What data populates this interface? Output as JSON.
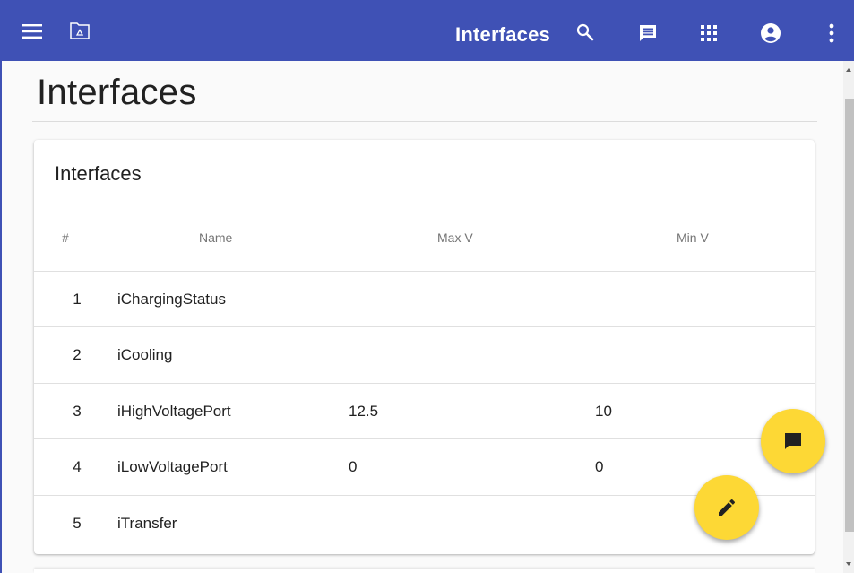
{
  "app_bar": {
    "title": "Interfaces",
    "background_color": "#3f51b5",
    "icons": [
      "menu-icon",
      "folder-icon",
      "search-icon",
      "chat-icon",
      "apps-icon",
      "account-icon",
      "more-vert-icon"
    ]
  },
  "page": {
    "title": "Interfaces"
  },
  "card": {
    "title": "Interfaces",
    "columns": [
      "#",
      "Name",
      "Max V",
      "Min V"
    ],
    "rows": [
      {
        "num": "1",
        "name": "iChargingStatus",
        "max_v": "",
        "min_v": ""
      },
      {
        "num": "2",
        "name": "iCooling",
        "max_v": "",
        "min_v": ""
      },
      {
        "num": "3",
        "name": "iHighVoltagePort",
        "max_v": "12.5",
        "min_v": "10"
      },
      {
        "num": "4",
        "name": "iLowVoltagePort",
        "max_v": "0",
        "min_v": "0"
      },
      {
        "num": "5",
        "name": "iTransfer",
        "max_v": "",
        "min_v": ""
      }
    ]
  },
  "fabs": {
    "color": "#fdd835",
    "chat_icon": "chat-icon",
    "edit_icon": "edit-icon"
  }
}
